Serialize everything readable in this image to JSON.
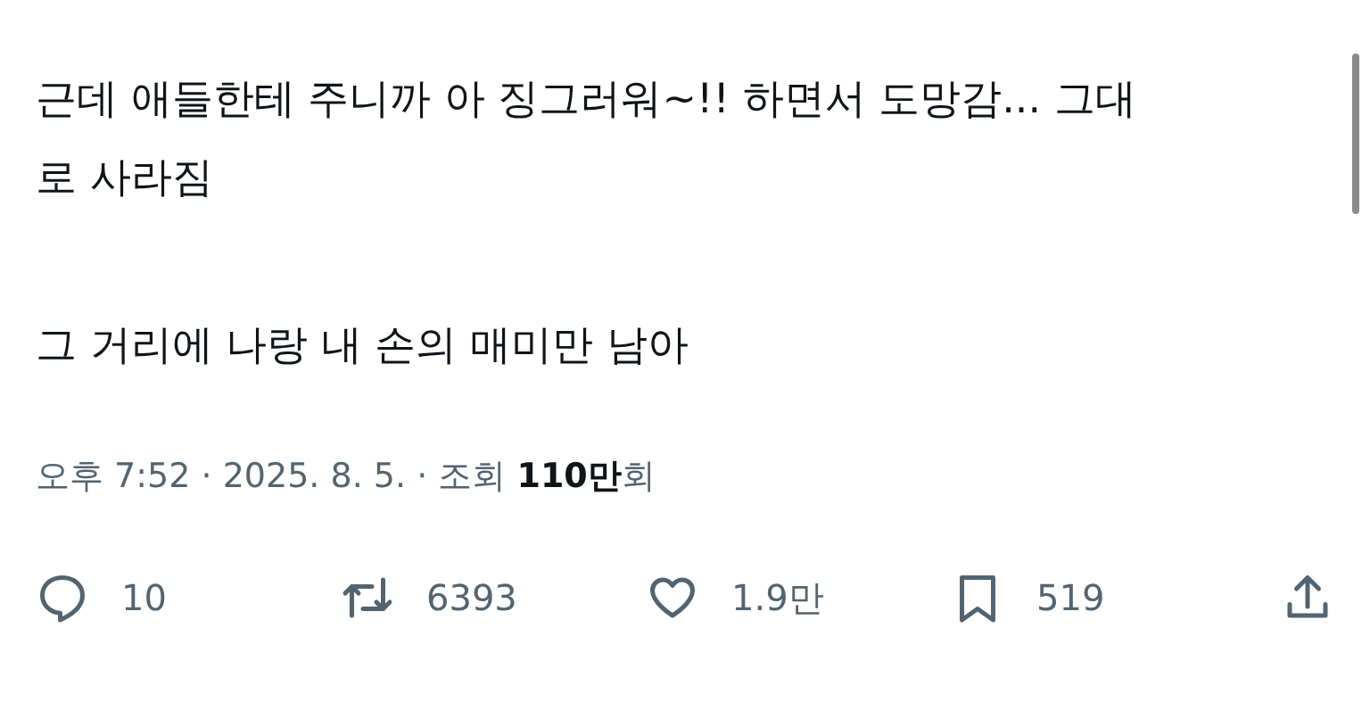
{
  "post": {
    "paragraphs": [
      "근데 애들한테 주니까 아 징그러워~!! 하면서 도망감... 그대로 사라짐",
      "그 거리에 나랑 내 손의 매미만 남아"
    ],
    "meta": "오후 7:52 · 2025. 8. 5. · 조회 **110만**회",
    "actions": [
      {
        "kind": "reply",
        "count": "10"
      },
      {
        "kind": "repost",
        "count": "6393"
      },
      {
        "kind": "like",
        "count": "1.9만"
      },
      {
        "kind": "bookmark",
        "count": "519"
      },
      {
        "kind": "share"
      }
    ]
  }
}
